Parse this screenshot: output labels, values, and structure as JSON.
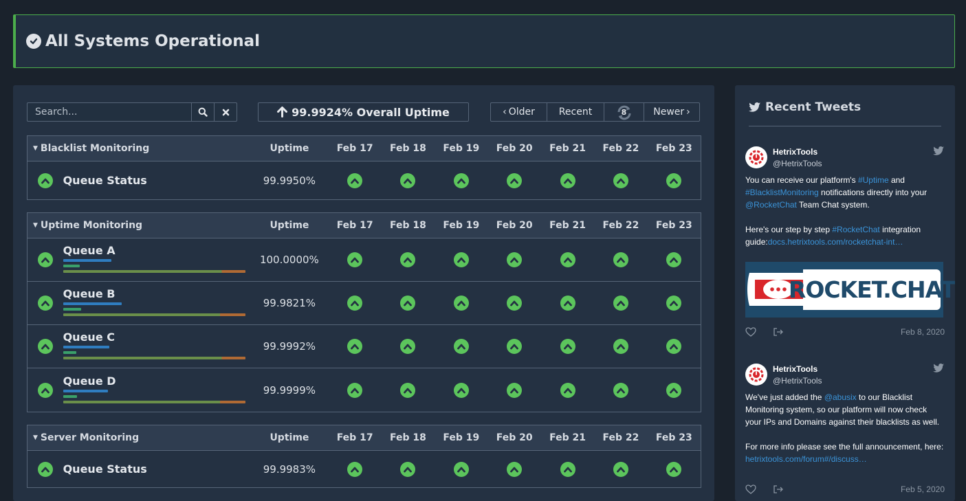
{
  "banner": {
    "title": "All Systems Operational"
  },
  "toolbar": {
    "search_placeholder": "Search...",
    "overall_uptime": "99.9924% Overall Uptime",
    "older": "Older",
    "recent": "Recent",
    "refresh_count": "8",
    "newer": "Newer"
  },
  "columns": {
    "uptime": "Uptime",
    "dates": [
      "Feb 17",
      "Feb 18",
      "Feb 19",
      "Feb 20",
      "Feb 21",
      "Feb 22",
      "Feb 23"
    ]
  },
  "groups": [
    {
      "name": "Blacklist Monitoring",
      "rows": [
        {
          "name": "Queue Status",
          "uptime": "99.9950%"
        }
      ]
    },
    {
      "name": "Uptime Monitoring",
      "rows": [
        {
          "name": "Queue A",
          "uptime": "100.0000%"
        },
        {
          "name": "Queue B",
          "uptime": "99.9821%"
        },
        {
          "name": "Queue C",
          "uptime": "99.9992%"
        },
        {
          "name": "Queue D",
          "uptime": "99.9999%"
        }
      ]
    },
    {
      "name": "Server Monitoring",
      "rows": [
        {
          "name": "Queue Status",
          "uptime": "99.9983%"
        }
      ]
    }
  ],
  "sidebar": {
    "title": "Recent Tweets",
    "tweets": [
      {
        "name": "HetrixTools",
        "handle": "@HetrixTools",
        "t1": "You can receive our platform's ",
        "l1": "#Uptime",
        "t2": " and ",
        "l2": "#BlacklistMonitoring",
        "t3": " notifications directly into your ",
        "l3": "@RocketChat",
        "t4": " Team Chat system.",
        "t5": "Here's our step by step ",
        "l4": "#RocketChat",
        "t6": " integration guide:",
        "l5": "docs.hetrixtools.com/rocketchat-int…",
        "image_text": "ROCKET.CHAT",
        "date": "Feb 8, 2020"
      },
      {
        "name": "HetrixTools",
        "handle": "@HetrixTools",
        "t1": "We've just added the ",
        "l1": "@abusix",
        "t2": " to our Blacklist Monitoring system, so our platform will now check your IPs and Domains against their blacklists as well.",
        "t3": "For more info please see the full announcement, here:",
        "l2": "hetrixtools.com/forum#/discuss…",
        "date": "Feb 5, 2020"
      }
    ]
  },
  "colors": {
    "ok": "#5cc55c",
    "bar_blue": "#2f7dc0",
    "bar_green": "#3aa06a",
    "bar_olive": "#6a8f4a",
    "bar_orange": "#b06a34",
    "link": "#3b94d9"
  }
}
